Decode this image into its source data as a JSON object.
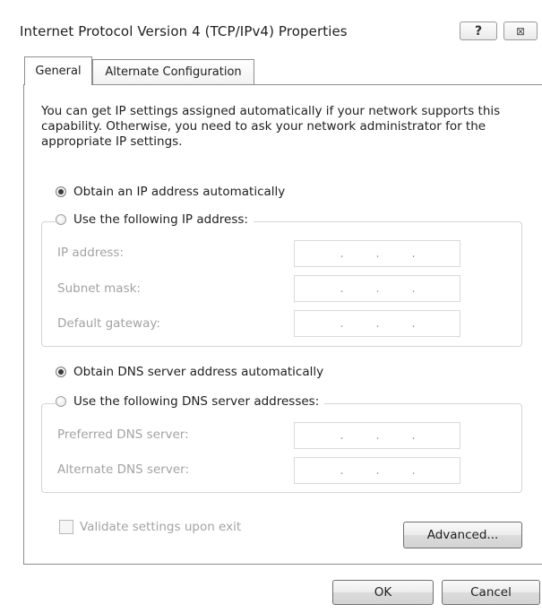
{
  "window": {
    "title": "Internet Protocol Version 4 (TCP/IPv4) Properties",
    "help_glyph": "?",
    "close_glyph": "⊠"
  },
  "tabs": [
    {
      "label": "General",
      "selected": true
    },
    {
      "label": "Alternate Configuration",
      "selected": false
    }
  ],
  "intro_text": "You can get IP settings assigned automatically if your network supports this capability. Otherwise, you need to ask your network administrator for the appropriate IP settings.",
  "ip_section": {
    "auto_label": "Obtain an IP address automatically",
    "auto_checked": true,
    "manual_label": "Use the following IP address:",
    "manual_checked": false,
    "fields": [
      {
        "label": "IP address:",
        "value": ". . ."
      },
      {
        "label": "Subnet mask:",
        "value": ". . ."
      },
      {
        "label": "Default gateway:",
        "value": ". . ."
      }
    ]
  },
  "dns_section": {
    "auto_label": "Obtain DNS server address automatically",
    "auto_checked": true,
    "manual_label": "Use the following DNS server addresses:",
    "manual_checked": false,
    "fields": [
      {
        "label": "Preferred DNS server:",
        "value": ". . ."
      },
      {
        "label": "Alternate DNS server:",
        "value": ". . ."
      }
    ]
  },
  "validate": {
    "label": "Validate settings upon exit",
    "checked": false
  },
  "buttons": {
    "advanced": "Advanced...",
    "ok": "OK",
    "cancel": "Cancel"
  }
}
